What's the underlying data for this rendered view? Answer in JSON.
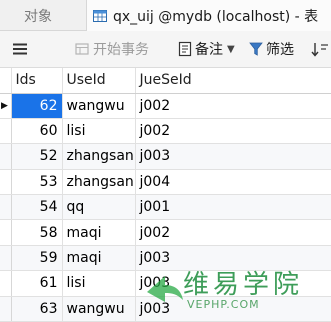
{
  "tabs": [
    {
      "label": "对象"
    },
    {
      "label": "qx_uij @mydb (localhost) - 表"
    }
  ],
  "toolbar": {
    "begin_transaction_label": "开始事务",
    "memo_label": "备注",
    "filter_label": "筛选"
  },
  "grid": {
    "columns": [
      "Ids",
      "UseId",
      "JueSeId"
    ],
    "rows": [
      {
        "ids": "62",
        "useid": "wangwu",
        "jueseid": "j002"
      },
      {
        "ids": "60",
        "useid": "lisi",
        "jueseid": "j002"
      },
      {
        "ids": "52",
        "useid": "zhangsan",
        "jueseid": "j003"
      },
      {
        "ids": "53",
        "useid": "zhangsan",
        "jueseid": "j004"
      },
      {
        "ids": "54",
        "useid": "qq",
        "jueseid": "j001"
      },
      {
        "ids": "58",
        "useid": "maqi",
        "jueseid": "j002"
      },
      {
        "ids": "59",
        "useid": "maqi",
        "jueseid": "j003"
      },
      {
        "ids": "61",
        "useid": "lisi",
        "jueseid": "j003"
      },
      {
        "ids": "63",
        "useid": "wangwu",
        "jueseid": "j003"
      }
    ],
    "selected_row": 0,
    "selection_color": "#1a73e8"
  },
  "watermark": {
    "name": "维易学院",
    "site": "VEPHP.COM"
  }
}
